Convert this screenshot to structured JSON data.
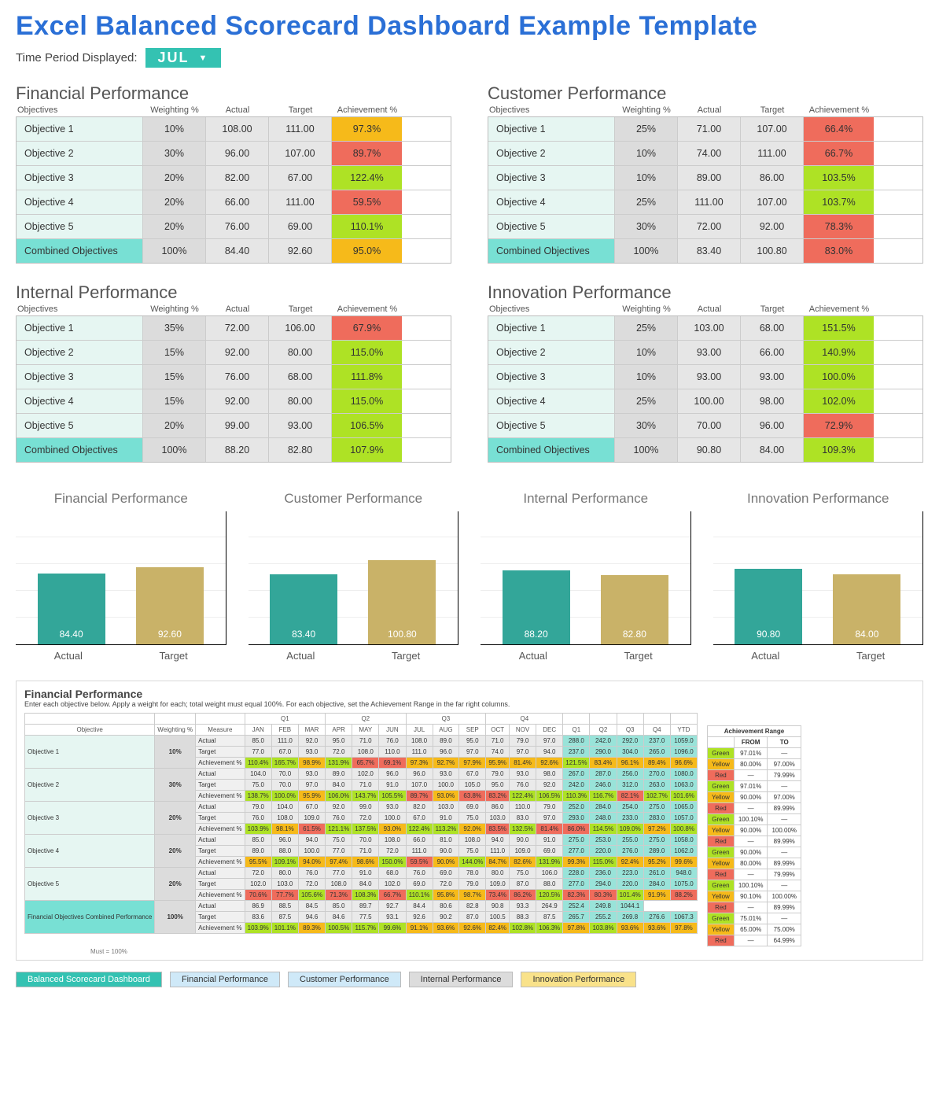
{
  "title": "Excel Balanced Scorecard Dashboard Example Template",
  "period_label": "Time Period Displayed:",
  "period_value": "JUL",
  "columns": {
    "obj": "Objectives",
    "wt": "Weighting %",
    "act": "Actual",
    "tgt": "Target",
    "ach": "Achievement %"
  },
  "combined_label": "Combined Objectives",
  "axis": {
    "actual": "Actual",
    "target": "Target"
  },
  "sections": {
    "financial": {
      "title": "Financial Performance",
      "rows": [
        {
          "name": "Objective 1",
          "wt": "10%",
          "act": "108.00",
          "tgt": "111.00",
          "ach": "97.3%",
          "cls": "yellow"
        },
        {
          "name": "Objective 2",
          "wt": "30%",
          "act": "96.00",
          "tgt": "107.00",
          "ach": "89.7%",
          "cls": "red"
        },
        {
          "name": "Objective 3",
          "wt": "20%",
          "act": "82.00",
          "tgt": "67.00",
          "ach": "122.4%",
          "cls": "green"
        },
        {
          "name": "Objective 4",
          "wt": "20%",
          "act": "66.00",
          "tgt": "111.00",
          "ach": "59.5%",
          "cls": "red"
        },
        {
          "name": "Objective 5",
          "wt": "20%",
          "act": "76.00",
          "tgt": "69.00",
          "ach": "110.1%",
          "cls": "green"
        }
      ],
      "combined": {
        "wt": "100%",
        "act": "84.40",
        "tgt": "92.60",
        "ach": "95.0%",
        "cls": "yellow"
      }
    },
    "customer": {
      "title": "Customer Performance",
      "rows": [
        {
          "name": "Objective 1",
          "wt": "25%",
          "act": "71.00",
          "tgt": "107.00",
          "ach": "66.4%",
          "cls": "red"
        },
        {
          "name": "Objective 2",
          "wt": "10%",
          "act": "74.00",
          "tgt": "111.00",
          "ach": "66.7%",
          "cls": "red"
        },
        {
          "name": "Objective 3",
          "wt": "10%",
          "act": "89.00",
          "tgt": "86.00",
          "ach": "103.5%",
          "cls": "green"
        },
        {
          "name": "Objective 4",
          "wt": "25%",
          "act": "111.00",
          "tgt": "107.00",
          "ach": "103.7%",
          "cls": "green"
        },
        {
          "name": "Objective 5",
          "wt": "30%",
          "act": "72.00",
          "tgt": "92.00",
          "ach": "78.3%",
          "cls": "red"
        }
      ],
      "combined": {
        "wt": "100%",
        "act": "83.40",
        "tgt": "100.80",
        "ach": "83.0%",
        "cls": "red"
      }
    },
    "internal": {
      "title": "Internal Performance",
      "rows": [
        {
          "name": "Objective 1",
          "wt": "35%",
          "act": "72.00",
          "tgt": "106.00",
          "ach": "67.9%",
          "cls": "red"
        },
        {
          "name": "Objective 2",
          "wt": "15%",
          "act": "92.00",
          "tgt": "80.00",
          "ach": "115.0%",
          "cls": "green"
        },
        {
          "name": "Objective 3",
          "wt": "15%",
          "act": "76.00",
          "tgt": "68.00",
          "ach": "111.8%",
          "cls": "green"
        },
        {
          "name": "Objective 4",
          "wt": "15%",
          "act": "92.00",
          "tgt": "80.00",
          "ach": "115.0%",
          "cls": "green"
        },
        {
          "name": "Objective 5",
          "wt": "20%",
          "act": "99.00",
          "tgt": "93.00",
          "ach": "106.5%",
          "cls": "green"
        }
      ],
      "combined": {
        "wt": "100%",
        "act": "88.20",
        "tgt": "82.80",
        "ach": "107.9%",
        "cls": "green"
      }
    },
    "innovation": {
      "title": "Innovation Performance",
      "rows": [
        {
          "name": "Objective 1",
          "wt": "25%",
          "act": "103.00",
          "tgt": "68.00",
          "ach": "151.5%",
          "cls": "green"
        },
        {
          "name": "Objective 2",
          "wt": "10%",
          "act": "93.00",
          "tgt": "66.00",
          "ach": "140.9%",
          "cls": "green"
        },
        {
          "name": "Objective 3",
          "wt": "10%",
          "act": "93.00",
          "tgt": "93.00",
          "ach": "100.0%",
          "cls": "green"
        },
        {
          "name": "Objective 4",
          "wt": "25%",
          "act": "100.00",
          "tgt": "98.00",
          "ach": "102.0%",
          "cls": "green"
        },
        {
          "name": "Objective 5",
          "wt": "30%",
          "act": "70.00",
          "tgt": "96.00",
          "ach": "72.9%",
          "cls": "red"
        }
      ],
      "combined": {
        "wt": "100%",
        "act": "90.80",
        "tgt": "84.00",
        "ach": "109.3%",
        "cls": "green"
      }
    }
  },
  "chart_data": [
    {
      "type": "bar",
      "title": "Financial Performance",
      "categories": [
        "Actual",
        "Target"
      ],
      "values": [
        84.4,
        92.6
      ],
      "ylim": [
        0,
        160
      ]
    },
    {
      "type": "bar",
      "title": "Customer Performance",
      "categories": [
        "Actual",
        "Target"
      ],
      "values": [
        83.4,
        100.8
      ],
      "ylim": [
        0,
        160
      ]
    },
    {
      "type": "bar",
      "title": "Internal Performance",
      "categories": [
        "Actual",
        "Target"
      ],
      "values": [
        88.2,
        82.8
      ],
      "ylim": [
        0,
        160
      ]
    },
    {
      "type": "bar",
      "title": "Innovation Performance",
      "categories": [
        "Actual",
        "Target"
      ],
      "values": [
        90.8,
        84.0
      ],
      "ylim": [
        0,
        160
      ]
    }
  ],
  "fp_detail": {
    "title": "Financial Performance",
    "desc": "Enter each objective below.  Apply a weight for each; total weight must equal 100%.  For each objective, set the Achievement Range in the far right columns.",
    "headers": {
      "obj": "Objective",
      "wt": "Weighting %",
      "meas": "Measure"
    },
    "quarters": [
      "Q1",
      "Q2",
      "Q3",
      "Q4"
    ],
    "months": [
      "JAN",
      "FEB",
      "MAR",
      "APR",
      "MAY",
      "JUN",
      "JUL",
      "AUG",
      "SEP",
      "OCT",
      "NOV",
      "DEC",
      "Q1",
      "Q2",
      "Q3",
      "Q4",
      "YTD"
    ],
    "measures": [
      "Actual",
      "Target",
      "Achievement %"
    ],
    "rows": [
      {
        "name": "Objective 1",
        "wt": "10%",
        "data": [
          [
            "85.0",
            "111.0",
            "92.0",
            "95.0",
            "71.0",
            "76.0",
            "108.0",
            "89.0",
            "95.0",
            "71.0",
            "79.0",
            "97.0",
            "288.0",
            "242.0",
            "292.0",
            "237.0",
            "1059.0"
          ],
          [
            "77.0",
            "67.0",
            "93.0",
            "72.0",
            "108.0",
            "110.0",
            "111.0",
            "96.0",
            "97.0",
            "74.0",
            "97.0",
            "94.0",
            "237.0",
            "290.0",
            "304.0",
            "265.0",
            "1096.0"
          ],
          [
            "110.4%",
            "165.7%",
            "98.9%",
            "131.9%",
            "65.7%",
            "69.1%",
            "97.3%",
            "92.7%",
            "97.9%",
            "95.9%",
            "81.4%",
            "92.6%",
            "121.5%",
            "83.4%",
            "96.1%",
            "89.4%",
            "96.6%"
          ]
        ],
        "ach_cls": [
          "g",
          "g",
          "y",
          "g",
          "r",
          "r",
          "y",
          "y",
          "y",
          "y",
          "y",
          "y",
          "g",
          "y",
          "y",
          "y",
          "y"
        ]
      },
      {
        "name": "Objective 2",
        "wt": "30%",
        "data": [
          [
            "104.0",
            "70.0",
            "93.0",
            "89.0",
            "102.0",
            "96.0",
            "96.0",
            "93.0",
            "67.0",
            "79.0",
            "93.0",
            "98.0",
            "267.0",
            "287.0",
            "256.0",
            "270.0",
            "1080.0"
          ],
          [
            "75.0",
            "70.0",
            "97.0",
            "84.0",
            "71.0",
            "91.0",
            "107.0",
            "100.0",
            "105.0",
            "95.0",
            "76.0",
            "92.0",
            "242.0",
            "246.0",
            "312.0",
            "263.0",
            "1063.0"
          ],
          [
            "138.7%",
            "100.0%",
            "95.9%",
            "106.0%",
            "143.7%",
            "105.5%",
            "89.7%",
            "93.0%",
            "63.8%",
            "83.2%",
            "122.4%",
            "106.5%",
            "110.3%",
            "116.7%",
            "82.1%",
            "102.7%",
            "101.6%"
          ]
        ],
        "ach_cls": [
          "g",
          "g",
          "y",
          "g",
          "g",
          "g",
          "r",
          "y",
          "r",
          "r",
          "g",
          "g",
          "g",
          "g",
          "r",
          "g",
          "g"
        ]
      },
      {
        "name": "Objective 3",
        "wt": "20%",
        "data": [
          [
            "79.0",
            "104.0",
            "67.0",
            "92.0",
            "99.0",
            "93.0",
            "82.0",
            "103.0",
            "69.0",
            "86.0",
            "110.0",
            "79.0",
            "252.0",
            "284.0",
            "254.0",
            "275.0",
            "1065.0"
          ],
          [
            "76.0",
            "108.0",
            "109.0",
            "76.0",
            "72.0",
            "100.0",
            "67.0",
            "91.0",
            "75.0",
            "103.0",
            "83.0",
            "97.0",
            "293.0",
            "248.0",
            "233.0",
            "283.0",
            "1057.0"
          ],
          [
            "103.9%",
            "98.1%",
            "61.5%",
            "121.1%",
            "137.5%",
            "93.0%",
            "122.4%",
            "113.2%",
            "92.0%",
            "83.5%",
            "132.5%",
            "81.4%",
            "86.0%",
            "114.5%",
            "109.0%",
            "97.2%",
            "100.8%"
          ]
        ],
        "ach_cls": [
          "g",
          "y",
          "r",
          "g",
          "g",
          "y",
          "g",
          "g",
          "y",
          "r",
          "g",
          "r",
          "r",
          "g",
          "g",
          "y",
          "g"
        ]
      },
      {
        "name": "Objective 4",
        "wt": "20%",
        "data": [
          [
            "85.0",
            "96.0",
            "94.0",
            "75.0",
            "70.0",
            "108.0",
            "66.0",
            "81.0",
            "108.0",
            "94.0",
            "90.0",
            "91.0",
            "275.0",
            "253.0",
            "255.0",
            "275.0",
            "1058.0"
          ],
          [
            "89.0",
            "88.0",
            "100.0",
            "77.0",
            "71.0",
            "72.0",
            "111.0",
            "90.0",
            "75.0",
            "111.0",
            "109.0",
            "69.0",
            "277.0",
            "220.0",
            "276.0",
            "289.0",
            "1062.0"
          ],
          [
            "95.5%",
            "109.1%",
            "94.0%",
            "97.4%",
            "98.6%",
            "150.0%",
            "59.5%",
            "90.0%",
            "144.0%",
            "84.7%",
            "82.6%",
            "131.9%",
            "99.3%",
            "115.0%",
            "92.4%",
            "95.2%",
            "99.6%"
          ]
        ],
        "ach_cls": [
          "y",
          "g",
          "y",
          "y",
          "y",
          "g",
          "r",
          "y",
          "g",
          "y",
          "y",
          "g",
          "y",
          "g",
          "y",
          "y",
          "y"
        ]
      },
      {
        "name": "Objective 5",
        "wt": "20%",
        "data": [
          [
            "72.0",
            "80.0",
            "76.0",
            "77.0",
            "91.0",
            "68.0",
            "76.0",
            "69.0",
            "78.0",
            "80.0",
            "75.0",
            "106.0",
            "228.0",
            "236.0",
            "223.0",
            "261.0",
            "948.0"
          ],
          [
            "102.0",
            "103.0",
            "72.0",
            "108.0",
            "84.0",
            "102.0",
            "69.0",
            "72.0",
            "79.0",
            "109.0",
            "87.0",
            "88.0",
            "277.0",
            "294.0",
            "220.0",
            "284.0",
            "1075.0"
          ],
          [
            "70.6%",
            "77.7%",
            "105.6%",
            "71.3%",
            "108.3%",
            "66.7%",
            "110.1%",
            "95.8%",
            "98.7%",
            "73.4%",
            "86.2%",
            "120.5%",
            "82.3%",
            "80.3%",
            "101.4%",
            "91.9%",
            "88.2%"
          ]
        ],
        "ach_cls": [
          "r",
          "r",
          "g",
          "r",
          "g",
          "r",
          "g",
          "y",
          "y",
          "r",
          "r",
          "g",
          "r",
          "r",
          "g",
          "y",
          "r"
        ]
      }
    ],
    "combined": {
      "name": "Financial Objectives Combined Performance",
      "wt": "100%",
      "data": [
        [
          "86.9",
          "88.5",
          "84.5",
          "85.0",
          "89.7",
          "92.7",
          "84.4",
          "80.6",
          "82.8",
          "90.8",
          "93.3",
          "264.9",
          "252.4",
          "249.8",
          "1044.1"
        ],
        [
          "83.6",
          "87.5",
          "94.6",
          "84.6",
          "77.5",
          "93.1",
          "92.6",
          "90.2",
          "87.0",
          "100.5",
          "88.3",
          "87.5",
          "265.7",
          "255.2",
          "269.8",
          "276.6",
          "1067.3"
        ],
        [
          "103.9%",
          "101.1%",
          "89.3%",
          "100.5%",
          "115.7%",
          "99.6%",
          "91.1%",
          "93.6%",
          "92.6%",
          "82.4%",
          "102.8%",
          "106.3%",
          "97.8%",
          "103.8%",
          "93.6%",
          "93.6%",
          "97.8%"
        ]
      ],
      "ach_cls": [
        "g",
        "g",
        "y",
        "g",
        "g",
        "g",
        "y",
        "y",
        "y",
        "y",
        "g",
        "g",
        "y",
        "g",
        "y",
        "y",
        "y"
      ]
    },
    "must": "Must = 100%",
    "range": {
      "title": "Achievement Range",
      "from": "FROM",
      "to": "TO",
      "rows": [
        {
          "label": "Green",
          "from": "97.01%",
          "to": "—"
        },
        {
          "label": "Yellow",
          "from": "80.00%",
          "to": "97.00%"
        },
        {
          "label": "Red",
          "from": "—",
          "to": "79.99%"
        },
        {
          "label": "Green",
          "from": "97.01%",
          "to": "—"
        },
        {
          "label": "Yellow",
          "from": "90.00%",
          "to": "97.00%"
        },
        {
          "label": "Red",
          "from": "—",
          "to": "89.99%"
        },
        {
          "label": "Green",
          "from": "100.10%",
          "to": "—"
        },
        {
          "label": "Yellow",
          "from": "90.00%",
          "to": "100.00%"
        },
        {
          "label": "Red",
          "from": "—",
          "to": "89.99%"
        },
        {
          "label": "Green",
          "from": "90.00%",
          "to": "—"
        },
        {
          "label": "Yellow",
          "from": "80.00%",
          "to": "89.99%"
        },
        {
          "label": "Red",
          "from": "—",
          "to": "79.99%"
        },
        {
          "label": "Green",
          "from": "100.10%",
          "to": "—"
        },
        {
          "label": "Yellow",
          "from": "90.10%",
          "to": "100.00%"
        },
        {
          "label": "Red",
          "from": "—",
          "to": "89.99%"
        },
        {
          "label": "Green",
          "from": "75.01%",
          "to": "—"
        },
        {
          "label": "Yellow",
          "from": "65.00%",
          "to": "75.00%"
        },
        {
          "label": "Red",
          "from": "—",
          "to": "64.99%"
        }
      ]
    }
  },
  "tabs": [
    "Balanced Scorecard Dashboard",
    "Financial Performance",
    "Customer Performance",
    "Internal Performance",
    "Innovation Performance"
  ]
}
